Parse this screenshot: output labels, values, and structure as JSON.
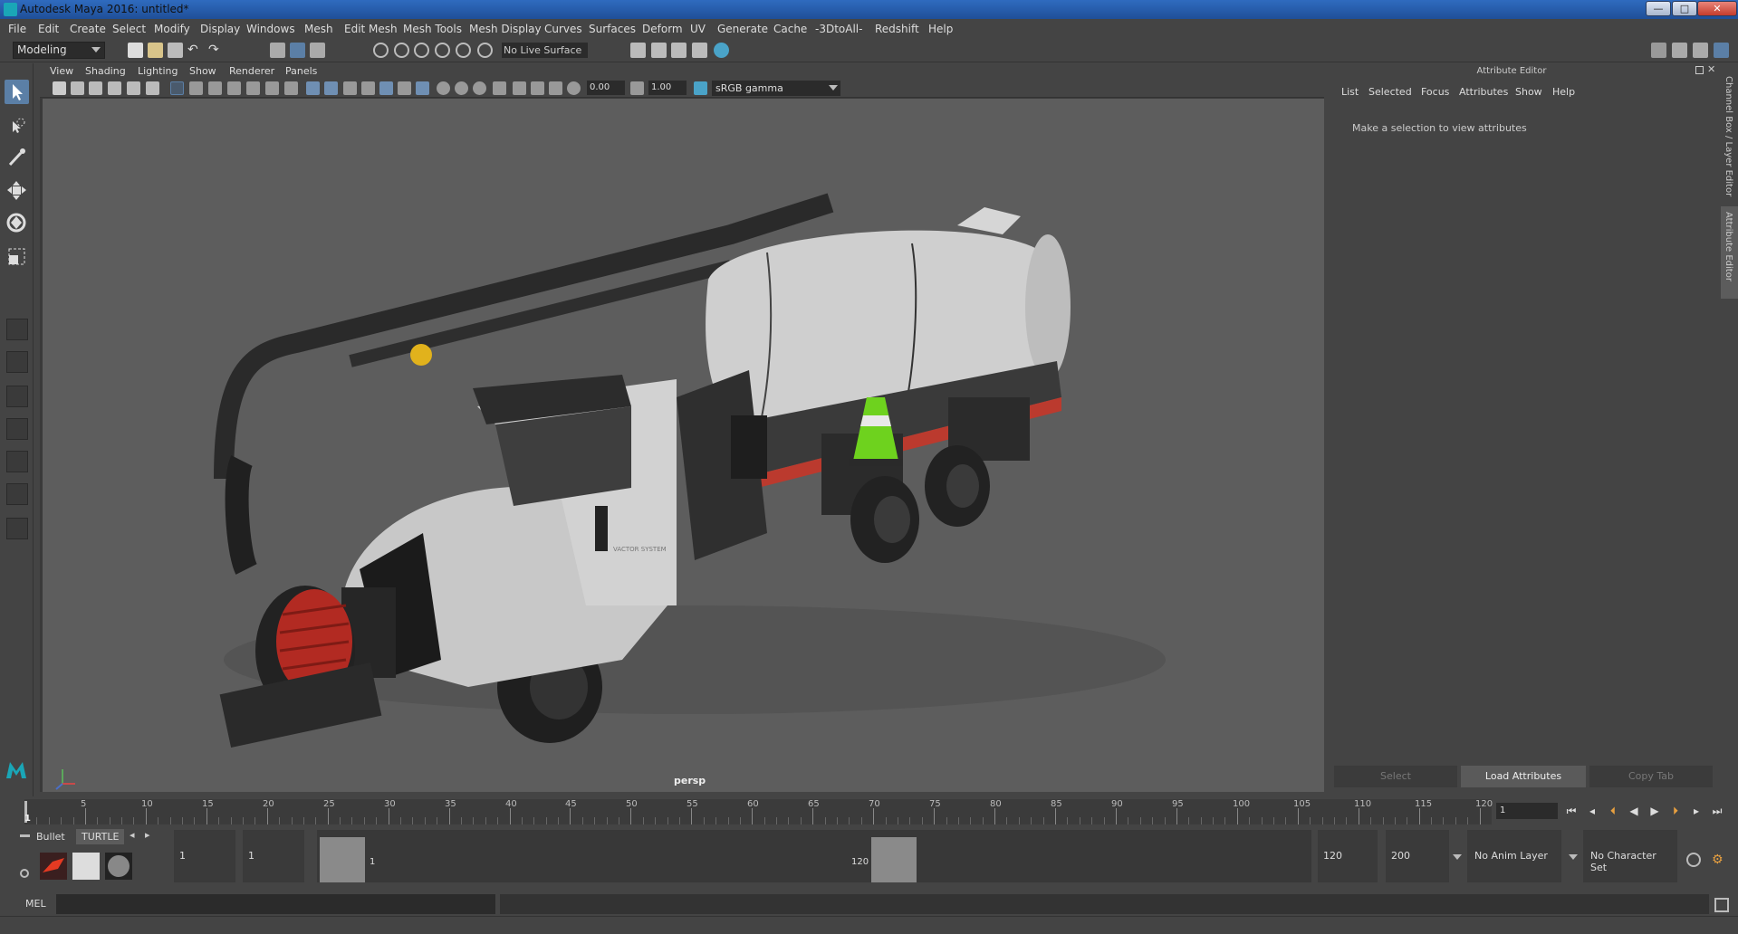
{
  "app": {
    "title": "Autodesk Maya 2016: untitled*",
    "window_buttons": {
      "minimize": "—",
      "maximize": "□",
      "close": "✕"
    }
  },
  "menubar": [
    "File",
    "Edit",
    "Create",
    "Select",
    "Modify",
    "Display",
    "Windows",
    "Mesh",
    "Edit Mesh",
    "Mesh Tools",
    "Mesh Display",
    "Curves",
    "Surfaces",
    "Deform",
    "UV",
    "Generate",
    "Cache",
    "-3DtoAll-",
    "Redshift",
    "Help"
  ],
  "shelfbar": {
    "mode": "Modeling",
    "live_surface": "No Live Surface"
  },
  "viewport": {
    "panel_menu": [
      "View",
      "Shading",
      "Lighting",
      "Show",
      "Renderer",
      "Panels"
    ],
    "exposure": "0.00",
    "gamma_value": "1.00",
    "color_space": "sRGB gamma",
    "camera_label": "persp",
    "truck_door_text": "VACTOR SYSTEM"
  },
  "attribute_editor": {
    "title": "Attribute Editor",
    "menu": [
      "List",
      "Selected",
      "Focus",
      "Attributes",
      "Show",
      "Help"
    ],
    "message": "Make a selection to view attributes",
    "buttons": {
      "select": "Select",
      "load": "Load Attributes",
      "copy": "Copy Tab"
    },
    "side_tabs": {
      "channel_box": "Channel Box / Layer Editor",
      "attribute_editor": "Attribute Editor"
    }
  },
  "timeslider": {
    "tick_labels": [
      "5",
      "10",
      "15",
      "20",
      "25",
      "30",
      "35",
      "40",
      "45",
      "50",
      "55",
      "60",
      "65",
      "70",
      "75",
      "80",
      "85",
      "90",
      "95",
      "100",
      "105",
      "110",
      "115",
      "120"
    ],
    "current_marker": "1",
    "current_frame": "1"
  },
  "rangebar": {
    "shelf_tabs": [
      "Bullet",
      "TURTLE"
    ],
    "start_frame": "1",
    "playback_start": "1",
    "range_start_label": "1",
    "range_end_label": "120",
    "playback_end": "120",
    "end_frame": "200",
    "anim_layer": "No Anim Layer",
    "character_set": "No Character Set"
  },
  "cmdline": {
    "label": "MEL"
  },
  "colors": {
    "accent": "#5b7fa6",
    "viewport_bg": "#5d5d5d",
    "title_bar": "#2f6bbf"
  }
}
